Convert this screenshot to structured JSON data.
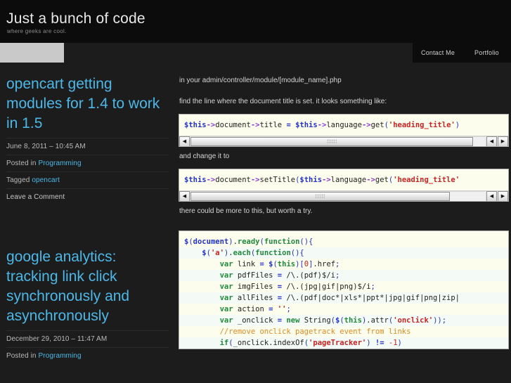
{
  "site": {
    "title": "Just a bunch of code",
    "tagline": "where geeks are cool."
  },
  "nav": {
    "items": [
      {
        "label": "Contact Me"
      },
      {
        "label": "Portfolio"
      }
    ]
  },
  "colors": {
    "link": "#4cb8e8",
    "header_bg": "#0c0c0c",
    "page_bg": "#1c1c1c",
    "code_bg": "#fdfdee",
    "code_string": "#cc2222",
    "code_keyword": "#1f8a3c",
    "code_variable": "#2233cc",
    "code_comment": "#e08a1e"
  },
  "posts": [
    {
      "title": "opencart getting modules for 1.4 to work in 1.5",
      "date": "June 8, 2011 – 10:45 AM",
      "posted_in_label": "Posted in",
      "category": "Programming",
      "tagged_label": "Tagged",
      "tag": "opencart",
      "comments_label": "Leave a Comment"
    },
    {
      "title": "google analytics: tracking link click synchronously and asynchronously",
      "date": "December 29, 2010 – 11:47 AM",
      "posted_in_label": "Posted in",
      "category": "Programming"
    }
  ],
  "main": {
    "paragraphs": {
      "intro": "in your admin/controller/module/[module_name].php",
      "find": "find the line where the document title is set. it looks something like:",
      "change": "and change it to",
      "worth": "there could be more to this, but worth a try."
    }
  },
  "code_blocks": [
    {
      "id": "php-before",
      "language": "php",
      "lines": [
        [
          {
            "t": "$this",
            "c": "t-var"
          },
          {
            "t": "->",
            "c": "t-op"
          },
          {
            "t": "document",
            "c": "t-ident"
          },
          {
            "t": "->",
            "c": "t-op"
          },
          {
            "t": "title",
            "c": "t-ident"
          },
          {
            "t": " ",
            "c": "t-plain"
          },
          {
            "t": "=",
            "c": "t-eq"
          },
          {
            "t": " ",
            "c": "t-plain"
          },
          {
            "t": "$this",
            "c": "t-var"
          },
          {
            "t": "->",
            "c": "t-op"
          },
          {
            "t": "language",
            "c": "t-ident"
          },
          {
            "t": "->",
            "c": "t-op"
          },
          {
            "t": "get",
            "c": "t-ident"
          },
          {
            "t": "(",
            "c": "t-punct"
          },
          {
            "t": "'heading_title'",
            "c": "t-str"
          },
          {
            "t": ")",
            "c": "t-punct"
          }
        ]
      ],
      "scrollbar": {
        "thumb_percent": 96
      }
    },
    {
      "id": "php-after",
      "language": "php",
      "lines": [
        [
          {
            "t": "$this",
            "c": "t-var"
          },
          {
            "t": "->",
            "c": "t-op"
          },
          {
            "t": "document",
            "c": "t-ident"
          },
          {
            "t": "->",
            "c": "t-op"
          },
          {
            "t": "setTitle",
            "c": "t-ident"
          },
          {
            "t": "(",
            "c": "t-punct"
          },
          {
            "t": "$this",
            "c": "t-var"
          },
          {
            "t": "->",
            "c": "t-op"
          },
          {
            "t": "language",
            "c": "t-ident"
          },
          {
            "t": "->",
            "c": "t-op"
          },
          {
            "t": "get",
            "c": "t-ident"
          },
          {
            "t": "(",
            "c": "t-punct"
          },
          {
            "t": "'heading_title'",
            "c": "t-str"
          }
        ]
      ],
      "scrollbar": {
        "thumb_percent": 88
      }
    },
    {
      "id": "js-analytics",
      "language": "javascript",
      "lines": [
        [
          {
            "t": "$",
            "c": "t-var"
          },
          {
            "t": "(",
            "c": "t-punct"
          },
          {
            "t": "document",
            "c": "t-var"
          },
          {
            "t": ")",
            "c": "t-punct"
          },
          {
            "t": ".",
            "c": "t-plain"
          },
          {
            "t": "ready",
            "c": "t-green"
          },
          {
            "t": "(",
            "c": "t-punct"
          },
          {
            "t": "function",
            "c": "t-kw"
          },
          {
            "t": "(){",
            "c": "t-punct"
          }
        ],
        [
          {
            "t": "    ",
            "c": "t-plain"
          },
          {
            "t": "$",
            "c": "t-var"
          },
          {
            "t": "(",
            "c": "t-punct"
          },
          {
            "t": "'a'",
            "c": "t-str"
          },
          {
            "t": ")",
            "c": "t-punct"
          },
          {
            "t": ".",
            "c": "t-plain"
          },
          {
            "t": "each",
            "c": "t-green"
          },
          {
            "t": "(",
            "c": "t-punct"
          },
          {
            "t": "function",
            "c": "t-kw"
          },
          {
            "t": "(){",
            "c": "t-punct"
          }
        ],
        [
          {
            "t": "        ",
            "c": "t-plain"
          },
          {
            "t": "var",
            "c": "t-kw"
          },
          {
            "t": " link ",
            "c": "t-plain"
          },
          {
            "t": "=",
            "c": "t-eq"
          },
          {
            "t": " ",
            "c": "t-plain"
          },
          {
            "t": "$",
            "c": "t-var"
          },
          {
            "t": "(",
            "c": "t-punct"
          },
          {
            "t": "this",
            "c": "t-kw"
          },
          {
            "t": ")[",
            "c": "t-punct"
          },
          {
            "t": "0",
            "c": "t-num"
          },
          {
            "t": "]",
            "c": "t-punct"
          },
          {
            "t": ".href",
            "c": "t-plain"
          },
          {
            "t": ";",
            "c": "t-punct"
          }
        ],
        [
          {
            "t": "        ",
            "c": "t-plain"
          },
          {
            "t": "var",
            "c": "t-kw"
          },
          {
            "t": " pdfFiles ",
            "c": "t-plain"
          },
          {
            "t": "=",
            "c": "t-eq"
          },
          {
            "t": " ",
            "c": "t-plain"
          },
          {
            "t": "/\\.(pdf)$/i",
            "c": "t-plain"
          },
          {
            "t": ";",
            "c": "t-punct"
          }
        ],
        [
          {
            "t": "        ",
            "c": "t-plain"
          },
          {
            "t": "var",
            "c": "t-kw"
          },
          {
            "t": " imgFiles ",
            "c": "t-plain"
          },
          {
            "t": "=",
            "c": "t-eq"
          },
          {
            "t": " ",
            "c": "t-plain"
          },
          {
            "t": "/\\.(jpg|gif|png)$/i",
            "c": "t-plain"
          },
          {
            "t": ";",
            "c": "t-punct"
          }
        ],
        [
          {
            "t": "        ",
            "c": "t-plain"
          },
          {
            "t": "var",
            "c": "t-kw"
          },
          {
            "t": " allFiles ",
            "c": "t-plain"
          },
          {
            "t": "=",
            "c": "t-eq"
          },
          {
            "t": " ",
            "c": "t-plain"
          },
          {
            "t": "/\\.(pdf|doc*|xls*|ppt*|jpg|gif|png|zip|",
            "c": "t-plain"
          }
        ],
        [
          {
            "t": "        ",
            "c": "t-plain"
          },
          {
            "t": "var",
            "c": "t-kw"
          },
          {
            "t": " action ",
            "c": "t-plain"
          },
          {
            "t": "=",
            "c": "t-eq"
          },
          {
            "t": " ",
            "c": "t-plain"
          },
          {
            "t": "''",
            "c": "t-str"
          },
          {
            "t": ";",
            "c": "t-punct"
          }
        ],
        [
          {
            "t": "        ",
            "c": "t-plain"
          },
          {
            "t": "var",
            "c": "t-kw"
          },
          {
            "t": " _onclick ",
            "c": "t-plain"
          },
          {
            "t": "=",
            "c": "t-eq"
          },
          {
            "t": " ",
            "c": "t-plain"
          },
          {
            "t": "new",
            "c": "t-kw"
          },
          {
            "t": " String",
            "c": "t-plain"
          },
          {
            "t": "(",
            "c": "t-punct"
          },
          {
            "t": "$",
            "c": "t-var"
          },
          {
            "t": "(",
            "c": "t-punct"
          },
          {
            "t": "this",
            "c": "t-kw"
          },
          {
            "t": ")",
            "c": "t-punct"
          },
          {
            "t": ".attr",
            "c": "t-plain"
          },
          {
            "t": "(",
            "c": "t-punct"
          },
          {
            "t": "'onclick'",
            "c": "t-str"
          },
          {
            "t": "));",
            "c": "t-punct"
          }
        ],
        [
          {
            "t": "        ",
            "c": "t-plain"
          },
          {
            "t": "//remove onclick pagetrack event from links",
            "c": "t-cmt"
          }
        ],
        [
          {
            "t": "        ",
            "c": "t-plain"
          },
          {
            "t": "if",
            "c": "t-kw"
          },
          {
            "t": "(",
            "c": "t-punct"
          },
          {
            "t": "_onclick",
            "c": "t-plain"
          },
          {
            "t": ".indexOf",
            "c": "t-plain"
          },
          {
            "t": "(",
            "c": "t-punct"
          },
          {
            "t": "'pageTracker'",
            "c": "t-str"
          },
          {
            "t": ")",
            "c": "t-punct"
          },
          {
            "t": " ",
            "c": "t-plain"
          },
          {
            "t": "!=",
            "c": "t-eq"
          },
          {
            "t": " ",
            "c": "t-plain"
          },
          {
            "t": "-1",
            "c": "t-num"
          },
          {
            "t": ")",
            "c": "t-punct"
          }
        ]
      ],
      "scrollbar": null
    }
  ],
  "scrollbar_icons": {
    "left_arrow": "◀",
    "right_arrow": "▶"
  }
}
